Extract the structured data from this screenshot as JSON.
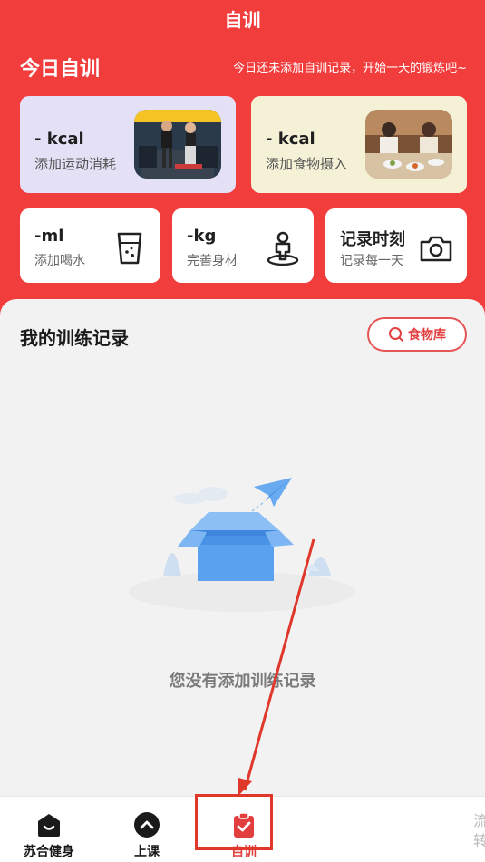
{
  "nav": {
    "title": "自训"
  },
  "header": {
    "title": "今日自训",
    "hint": "今日还未添加自训记录，开始一天的锻炼吧~"
  },
  "cards": {
    "sport": {
      "value": "- kcal",
      "label": "添加运动消耗"
    },
    "food": {
      "value": "- kcal",
      "label": "添加食物摄入"
    },
    "water": {
      "value": "-ml",
      "label": "添加喝水"
    },
    "weight": {
      "value": "-kg",
      "label": "完善身材"
    },
    "moment": {
      "value": "记录时刻",
      "label": "记录每一天"
    }
  },
  "records": {
    "title": "我的训练记录",
    "food_db_button": "食物库",
    "empty_text": "您没有添加训练记录"
  },
  "tabbar": {
    "home": "苏合健身",
    "class": "上课",
    "self": "自训",
    "partial_text": "流转"
  },
  "colors": {
    "brand_red": "#f23d3d",
    "highlight_red": "#e0372b",
    "box_blue": "#5aa2f0"
  },
  "icons": [
    "cup-icon",
    "body-icon",
    "camera-icon",
    "search-icon",
    "home-icon",
    "chevron-up-icon",
    "clipboard-check-icon",
    "box-icon",
    "paper-plane-icon"
  ]
}
